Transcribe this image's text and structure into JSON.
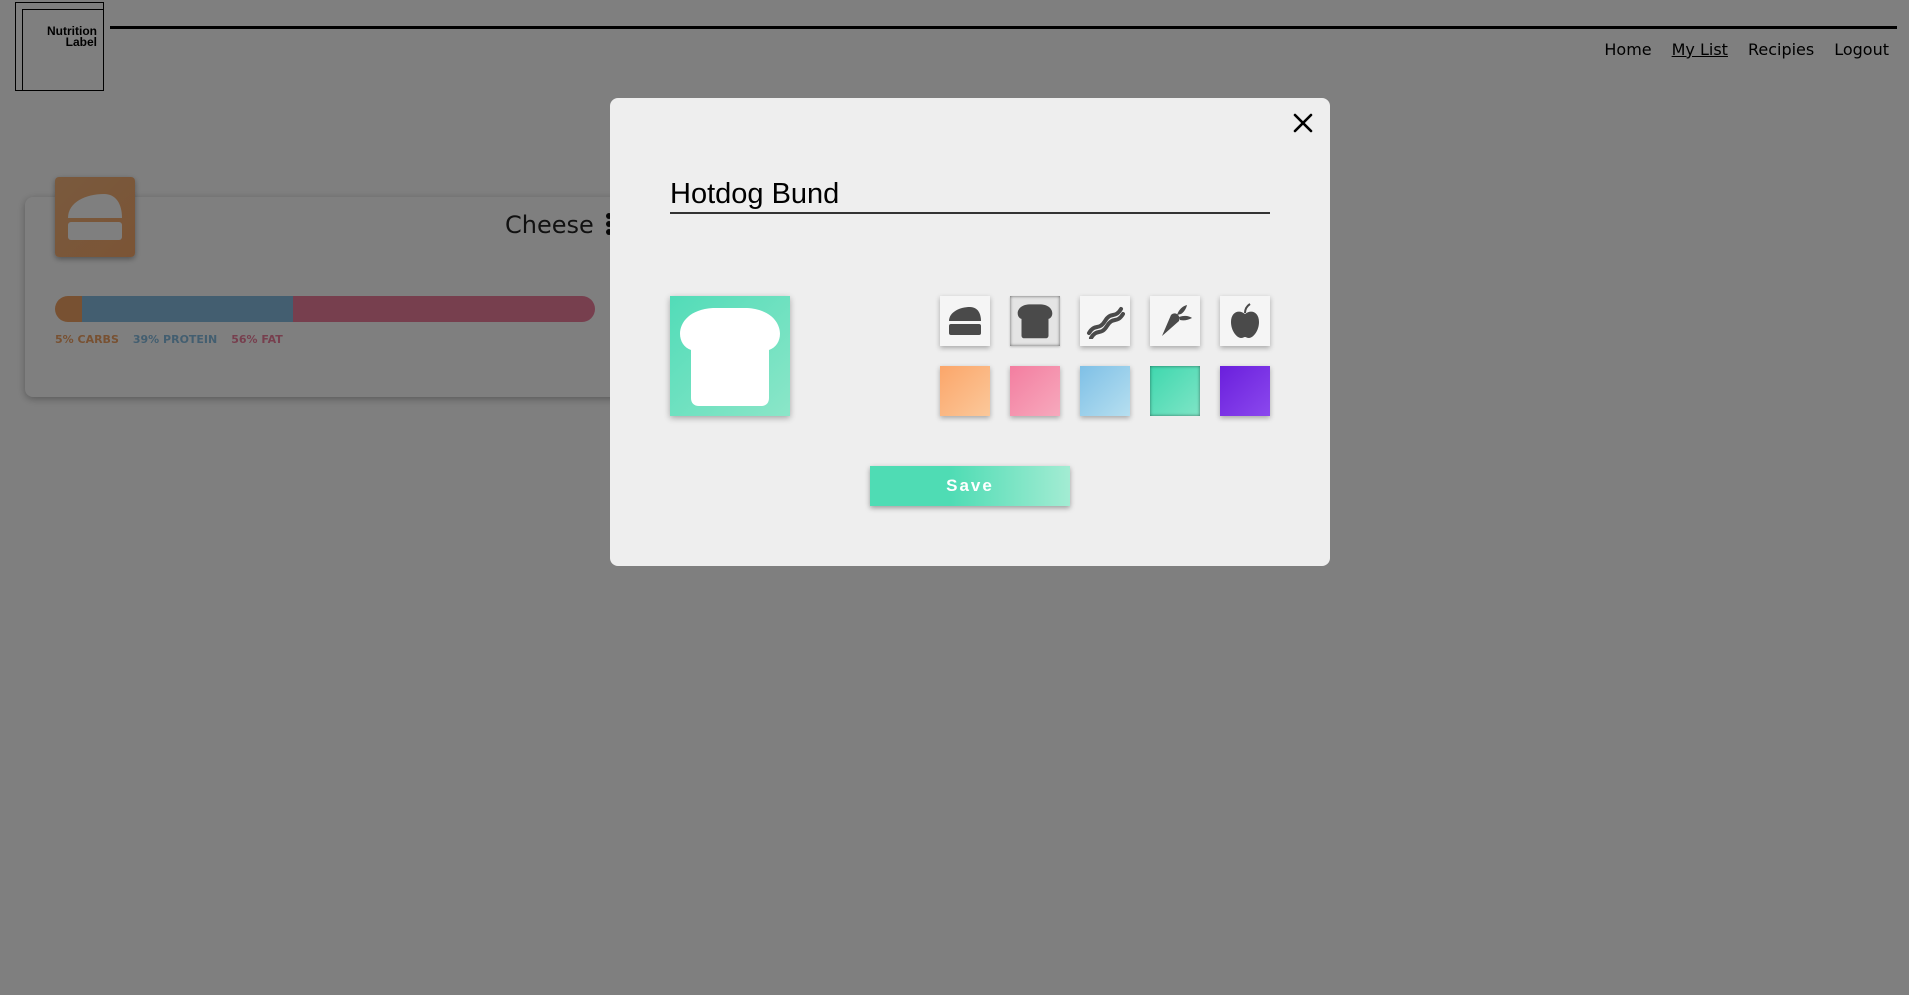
{
  "logo": {
    "line1": "Nutrition",
    "line2": "Label"
  },
  "nav": {
    "items": [
      {
        "label": "Home",
        "active": false
      },
      {
        "label": "My List",
        "active": true
      },
      {
        "label": "Recipies",
        "active": false
      },
      {
        "label": "Logout",
        "active": false
      }
    ]
  },
  "food_card": {
    "title": "Cheese",
    "icon": "cheese-icon",
    "color": "#f5ae72",
    "macros": [
      {
        "label": "5% CARBS",
        "percent": 5,
        "color": "#f0a264"
      },
      {
        "label": "39% PROTEIN",
        "percent": 39,
        "color": "#86bde0"
      },
      {
        "label": "56% FAT",
        "percent": 56,
        "color": "#ef7f9d"
      }
    ]
  },
  "modal": {
    "close_icon": "close-icon",
    "name_value": "Hotdog Bund",
    "preview": {
      "icon": "bread-icon",
      "color": "#52dcb8"
    },
    "icon_options": [
      {
        "name": "cheese-icon",
        "selected": false
      },
      {
        "name": "bread-icon",
        "selected": true
      },
      {
        "name": "bacon-icon",
        "selected": false
      },
      {
        "name": "carrot-icon",
        "selected": false
      },
      {
        "name": "apple-icon",
        "selected": false
      }
    ],
    "color_options": [
      {
        "name": "orange",
        "color": "#fbb379",
        "selected": false
      },
      {
        "name": "pink",
        "color": "#f48fab",
        "selected": false
      },
      {
        "name": "blue",
        "color": "#8cc8e8",
        "selected": false
      },
      {
        "name": "teal",
        "color": "#52dcb8",
        "selected": true
      },
      {
        "name": "purple",
        "color": "#7a2ee0",
        "selected": false
      }
    ],
    "save_label": "Save"
  }
}
